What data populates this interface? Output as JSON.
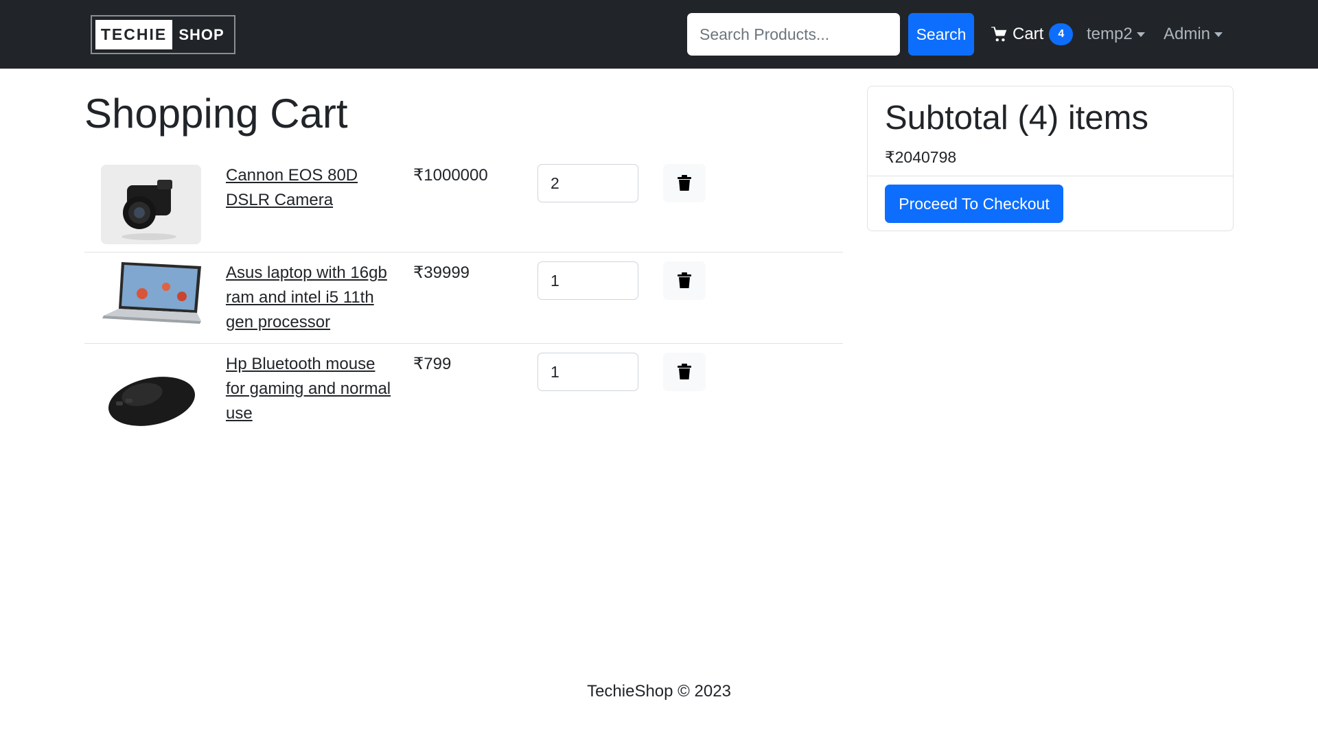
{
  "navbar": {
    "logo_left": "TECHIE",
    "logo_right": "SHOP",
    "search_placeholder": "Search Products...",
    "search_button": "Search",
    "cart_label": "Cart",
    "cart_count": "4",
    "user_menu": "temp2",
    "admin_menu": "Admin"
  },
  "main": {
    "title": "Shopping Cart",
    "items": [
      {
        "name": "Cannon EOS 80D DSLR Camera",
        "price": "₹1000000",
        "quantity": "2",
        "image": "camera"
      },
      {
        "name": "Asus laptop with 16gb ram and intel i5 11th gen processor",
        "price": "₹39999",
        "quantity": "1",
        "image": "laptop"
      },
      {
        "name": "Hp Bluetooth mouse for gaming and normal use",
        "price": "₹799",
        "quantity": "1",
        "image": "mouse"
      }
    ],
    "delete_icon": "trash-icon"
  },
  "summary": {
    "title": "Subtotal (4) items",
    "total": "₹2040798",
    "checkout_button": "Proceed To Checkout"
  },
  "footer": {
    "text": "TechieShop © 2023"
  },
  "colors": {
    "navbar_bg": "#212529",
    "primary": "#0d6efd",
    "text": "#212529"
  }
}
